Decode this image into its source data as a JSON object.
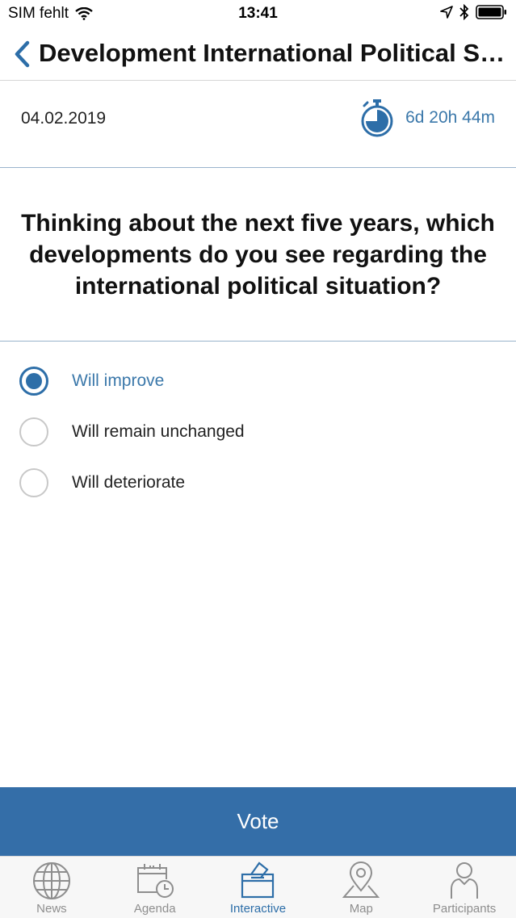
{
  "status_bar": {
    "carrier": "SIM fehlt",
    "time": "13:41"
  },
  "nav": {
    "title": "Development International Political Situation"
  },
  "meta": {
    "date": "04.02.2019",
    "remaining": "6d 20h 44m"
  },
  "question": {
    "text": "Thinking about the next five years, which developments do you see regarding the international political situation?"
  },
  "options": [
    {
      "label": "Will improve",
      "selected": true
    },
    {
      "label": "Will remain unchanged",
      "selected": false
    },
    {
      "label": "Will deteriorate",
      "selected": false
    }
  ],
  "vote_label": "Vote",
  "tabs": [
    {
      "label": "News",
      "icon": "globe-icon",
      "active": false
    },
    {
      "label": "Agenda",
      "icon": "calendar-clock-icon",
      "active": false
    },
    {
      "label": "Interactive",
      "icon": "ballot-box-icon",
      "active": true
    },
    {
      "label": "Map",
      "icon": "map-pin-icon",
      "active": false
    },
    {
      "label": "Participants",
      "icon": "person-icon",
      "active": false
    }
  ],
  "colors": {
    "accent": "#2d6ea8",
    "vote_bg": "#346ea8",
    "inactive": "#8e8e8e"
  }
}
